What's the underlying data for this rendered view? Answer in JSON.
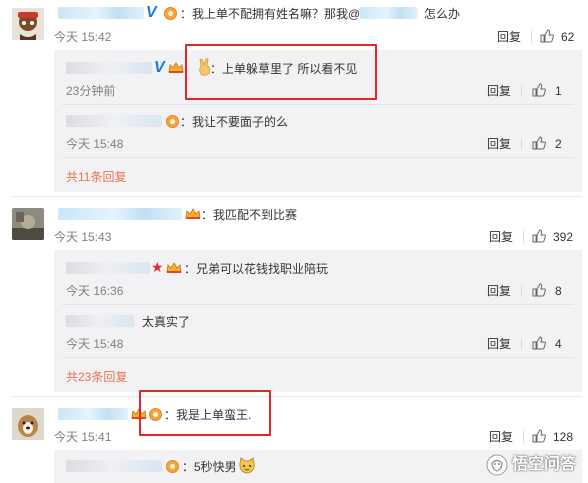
{
  "comments": [
    {
      "text": "：我上单不配拥有姓名嘛？那我@",
      "text_tail": "怎么办",
      "time": "今天 15:42",
      "reply_label": "回复",
      "likes": "62",
      "replies": [
        {
          "text": "：上单躲草里了 所以看不见",
          "time": "23分钟前",
          "reply_label": "回复",
          "likes": "1"
        },
        {
          "text": "：我让不要面子的么",
          "time": "今天 15:48",
          "reply_label": "回复",
          "likes": "2"
        }
      ],
      "more": "共11条回复"
    },
    {
      "text": "：我匹配不到比赛",
      "time": "今天 15:43",
      "reply_label": "回复",
      "likes": "392",
      "replies": [
        {
          "text": "：兄弟可以花钱找职业陪玩",
          "time": "今天 16:36",
          "reply_label": "回复",
          "likes": "8"
        },
        {
          "text": "太真实了",
          "time": "今天 15:48",
          "reply_label": "回复",
          "likes": "4"
        }
      ],
      "more": "共23条回复"
    },
    {
      "text": "：我是上单蛮王.",
      "time": "今天 15:41",
      "reply_label": "回复",
      "likes": "128",
      "replies": [
        {
          "text": "：5秒快男"
        }
      ]
    }
  ],
  "watermark": {
    "text": "悟空问答"
  },
  "colors": {
    "highlight_box": "#e0282a",
    "more_link": "#eb7350",
    "verified": "#1a7ed1"
  }
}
